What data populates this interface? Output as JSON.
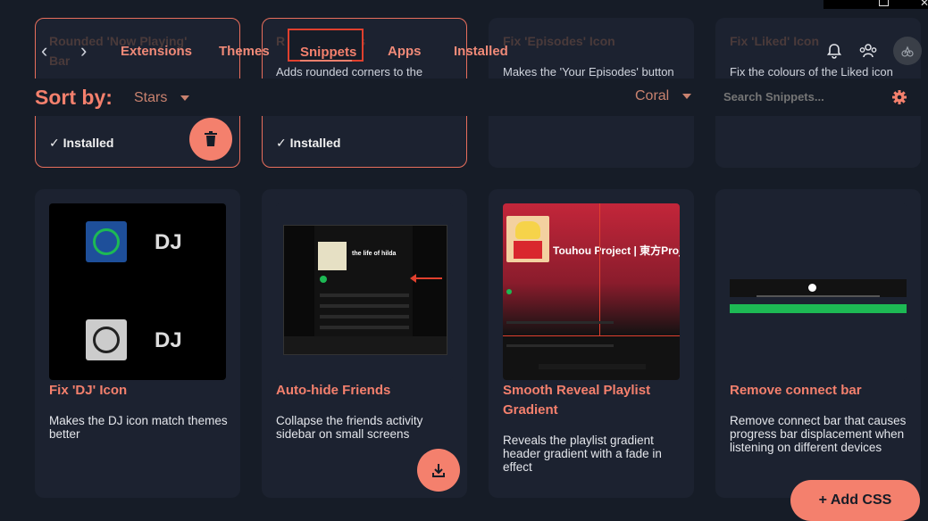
{
  "nav": {
    "tabs": [
      {
        "label": "Extensions"
      },
      {
        "label": "Themes"
      },
      {
        "label": "Snippets"
      },
      {
        "label": "Apps"
      },
      {
        "label": "Installed"
      }
    ]
  },
  "sort": {
    "label": "Sort by:",
    "value": "Stars"
  },
  "theme_select": {
    "value": "Coral"
  },
  "search": {
    "placeholder": "Search Snippets..."
  },
  "top_cards": [
    {
      "title_partial": "Rounded 'Now Playing'",
      "title_partial2": "Bar",
      "status": "Installed"
    },
    {
      "title_partial": "R          ges",
      "desc_partial": "Adds rounded corners to the",
      "status": "Installed"
    },
    {
      "title_partial": "Fix 'Episodes' Icon",
      "desc_partial": "Makes the 'Your Episodes' button"
    },
    {
      "title_partial": "Fix 'Liked' Icon",
      "desc_partial": "Fix the colours of the Liked icon"
    }
  ],
  "cards": [
    {
      "title": "Fix 'DJ' Icon",
      "desc": "Makes the DJ icon match themes better",
      "thumb_text": "DJ"
    },
    {
      "title": "Auto-hide Friends",
      "desc": "Collapse the friends activity sidebar on small screens",
      "thumb_text": "the life of hilda"
    },
    {
      "title": "Smooth Reveal Playlist Gradient",
      "desc": "Reveals the playlist gradient header gradient with a fade in effect",
      "thumb_text": "Touhou Project | 東方Project"
    },
    {
      "title": "Remove connect bar",
      "desc": "Remove connect bar that causes progress bar displacement when listening on different devices"
    }
  ],
  "add_css": {
    "label": "+ Add CSS"
  },
  "colors": {
    "accent": "#f4806d",
    "background": "#161c27",
    "card": "#1c2230"
  }
}
